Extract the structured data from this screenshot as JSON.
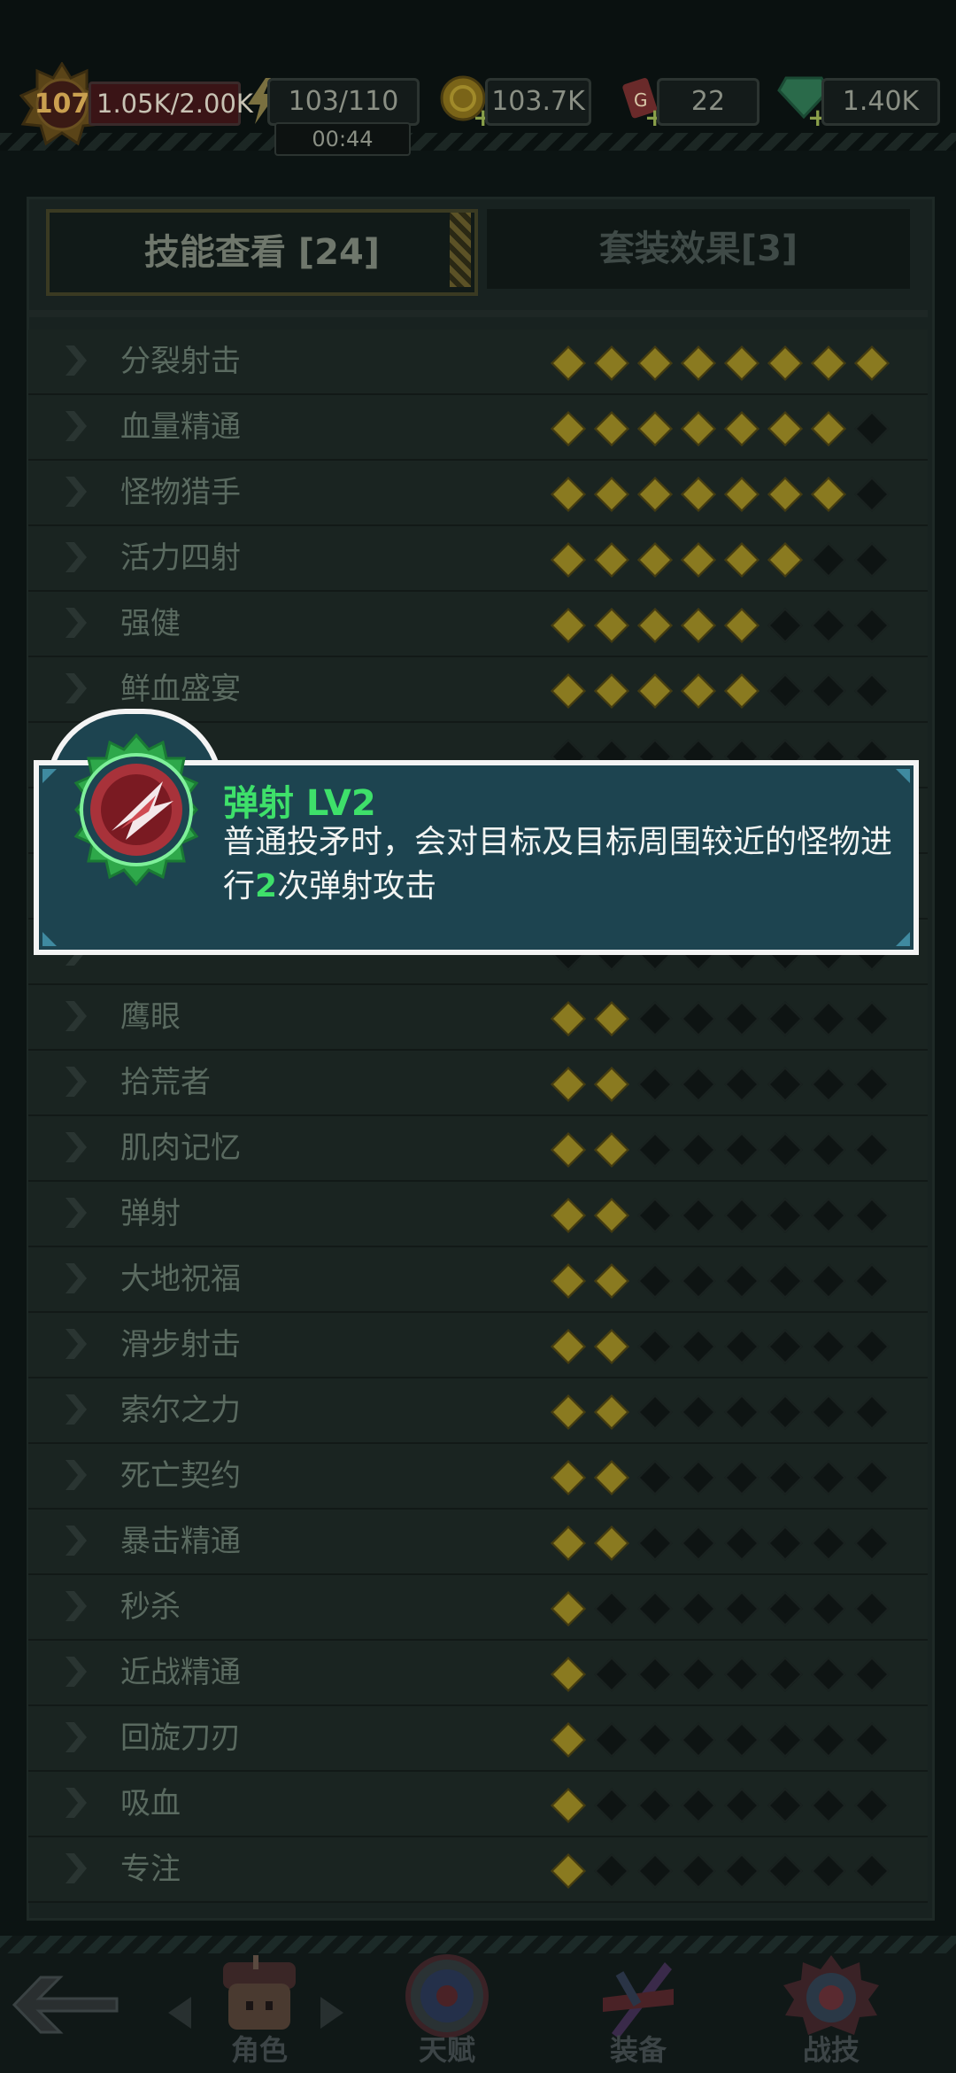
{
  "status": {
    "level": "107",
    "xp": "1.05K/2.00K",
    "energy": "103/110",
    "energy_timer": "00:44",
    "coins": "103.7K",
    "tickets": "22",
    "gems": "1.40K"
  },
  "tabs": {
    "skills": "技能查看 [24]",
    "sets": "套装效果[3]"
  },
  "skills": [
    {
      "name": "分裂射击",
      "level": 8
    },
    {
      "name": "血量精通",
      "level": 7
    },
    {
      "name": "怪物猎手",
      "level": 7
    },
    {
      "name": "活力四射",
      "level": 6
    },
    {
      "name": "强健",
      "level": 5
    },
    {
      "name": "鲜血盛宴",
      "level": 5
    },
    {
      "name": "",
      "level": 0
    },
    {
      "name": "",
      "level": 0
    },
    {
      "name": "",
      "level": 0
    },
    {
      "name": "",
      "level": 0
    },
    {
      "name": "鹰眼",
      "level": 2
    },
    {
      "name": "拾荒者",
      "level": 2
    },
    {
      "name": "肌肉记忆",
      "level": 2
    },
    {
      "name": "弹射",
      "level": 2
    },
    {
      "name": "大地祝福",
      "level": 2
    },
    {
      "name": "滑步射击",
      "level": 2
    },
    {
      "name": "索尔之力",
      "level": 2
    },
    {
      "name": "死亡契约",
      "level": 2
    },
    {
      "name": "暴击精通",
      "level": 2
    },
    {
      "name": "秒杀",
      "level": 1
    },
    {
      "name": "近战精通",
      "level": 1
    },
    {
      "name": "回旋刀刃",
      "level": 1
    },
    {
      "name": "吸血",
      "level": 1
    },
    {
      "name": "专注",
      "level": 1
    }
  ],
  "popup": {
    "title": "弹射 LV2",
    "desc_before": "普通投矛时，会对目标及目标周围较近的怪物进行",
    "desc_num": "2",
    "desc_after": "次弹射攻击"
  },
  "nav": {
    "role": "角色",
    "talent": "天赋",
    "equipment": "装备",
    "battle_skill": "战技"
  },
  "colors": {
    "popup_bg": "#1d4450",
    "popup_highlight": "#3ee06a",
    "dot_on": "#8a7a20"
  }
}
